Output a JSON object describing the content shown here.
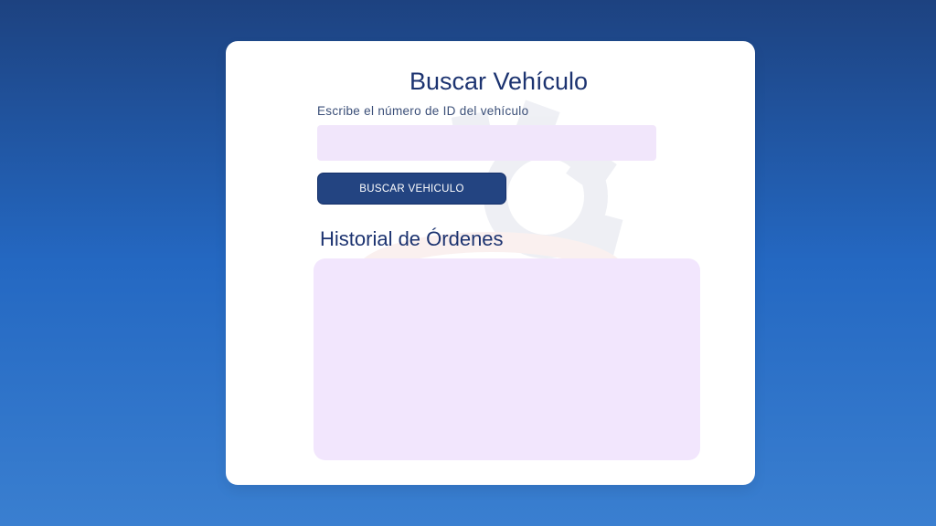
{
  "search_card": {
    "title": "Buscar Vehículo",
    "id_label": "Escribe el número de ID del vehículo",
    "id_value": "",
    "id_placeholder": "",
    "search_button_label": "BUSCAR VEHICULO"
  },
  "history": {
    "title": "Historial de Órdenes",
    "orders": []
  },
  "watermark": {
    "icon": "gear-icon"
  },
  "colors": {
    "background_top": "#1d4280",
    "background_bottom": "#3a7fd0",
    "card": "#ffffff",
    "accent": "#234481",
    "title": "#1c3370",
    "field_fill": "#f1e6fb"
  }
}
